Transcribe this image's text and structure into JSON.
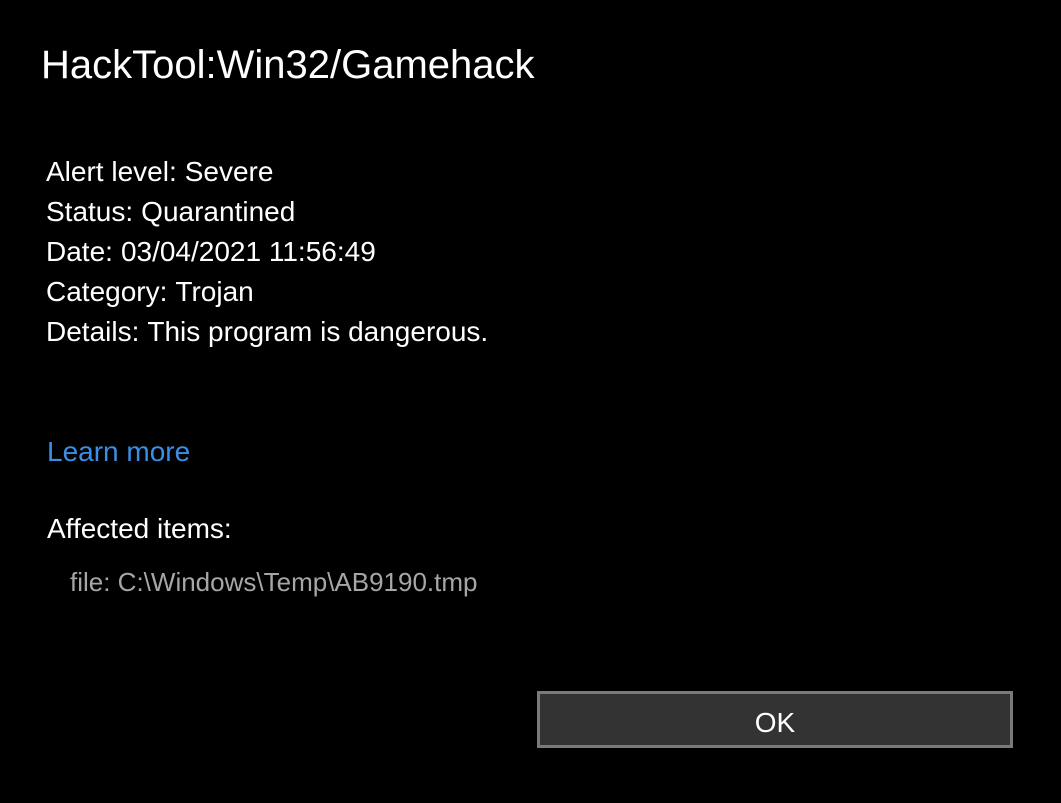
{
  "dialog": {
    "title": "HackTool:Win32/Gamehack",
    "details": [
      {
        "label": "Alert level:",
        "value": "Severe"
      },
      {
        "label": "Status:",
        "value": "Quarantined"
      },
      {
        "label": "Date:",
        "value": "03/04/2021 11:56:49"
      },
      {
        "label": "Category:",
        "value": "Trojan"
      },
      {
        "label": "Details:",
        "value": "This program is dangerous."
      }
    ],
    "learn_more": "Learn more",
    "affected_heading": "Affected items:",
    "affected_items": [
      "file: C:\\Windows\\Temp\\AB9190.tmp"
    ],
    "ok_label": "OK"
  },
  "colors": {
    "background": "#000000",
    "text": "#ffffff",
    "link": "#3b8ee6",
    "muted_text": "#a6a6a6",
    "button_bg": "#333333",
    "button_border": "#7a7a7a"
  }
}
